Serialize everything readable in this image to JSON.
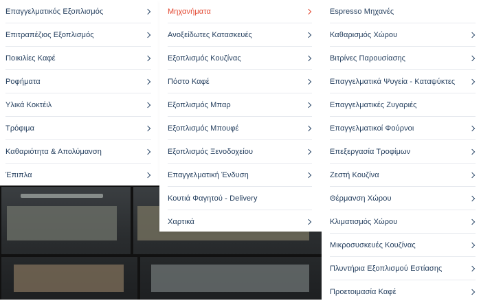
{
  "columns": [
    {
      "items": [
        {
          "label": "Επαγγελματικός Εξοπλισμός",
          "chevron": true
        },
        {
          "label": "Επιτραπέζιος Εξοπλισμός",
          "chevron": true
        },
        {
          "label": "Ποικιλίες Καφέ",
          "chevron": true
        },
        {
          "label": "Ροφήματα",
          "chevron": true
        },
        {
          "label": "Υλικά Κοκτέιλ",
          "chevron": true
        },
        {
          "label": "Τρόφιμα",
          "chevron": true
        },
        {
          "label": "Καθαριότητα & Απολύμανση",
          "chevron": true
        },
        {
          "label": "Έπιπλα",
          "chevron": true
        }
      ]
    },
    {
      "items": [
        {
          "label": "Μηχανήματα",
          "chevron": true,
          "active": true
        },
        {
          "label": "Ανοξείδωτες Κατασκευές",
          "chevron": true
        },
        {
          "label": "Εξοπλισμός Κουζίνας",
          "chevron": true
        },
        {
          "label": "Πόστο Καφέ",
          "chevron": true
        },
        {
          "label": "Εξοπλισμός Μπαρ",
          "chevron": true
        },
        {
          "label": "Εξοπλισμός Μπουφέ",
          "chevron": true
        },
        {
          "label": "Εξοπλισμός Ξενοδοχείου",
          "chevron": true
        },
        {
          "label": "Επαγγελματική Ένδυση",
          "chevron": true
        },
        {
          "label": "Κουτιά Φαγητού - Delivery",
          "chevron": false
        },
        {
          "label": "Χαρτικά",
          "chevron": true
        }
      ]
    },
    {
      "items": [
        {
          "label": "Espresso Μηχανές",
          "chevron": false
        },
        {
          "label": "Καθαρισμός Χώρου",
          "chevron": true
        },
        {
          "label": "Βιτρίνες Παρουσίασης",
          "chevron": true
        },
        {
          "label": "Επαγγελματικά Ψυγεία - Καταψύκτες",
          "chevron": true
        },
        {
          "label": "Επαγγελματικές Ζυγαριές",
          "chevron": false
        },
        {
          "label": "Επαγγελματικοί Φούρνοι",
          "chevron": true
        },
        {
          "label": "Επεξεργασία Τροφίμων",
          "chevron": true
        },
        {
          "label": "Ζεστή Κουζίνα",
          "chevron": true
        },
        {
          "label": "Θέρμανση Χώρου",
          "chevron": true
        },
        {
          "label": "Κλιματισμός Χώρου",
          "chevron": true
        },
        {
          "label": "Μικροσυσκευές Κουζίνας",
          "chevron": true
        },
        {
          "label": "Πλυντήρια Εξοπλισμού Εστίασης",
          "chevron": true
        },
        {
          "label": "Προετοιμασία Καφέ",
          "chevron": true
        }
      ]
    }
  ],
  "colors": {
    "text": "#1f3a5a",
    "active": "#e2462f",
    "divider": "#e6e9ee"
  }
}
